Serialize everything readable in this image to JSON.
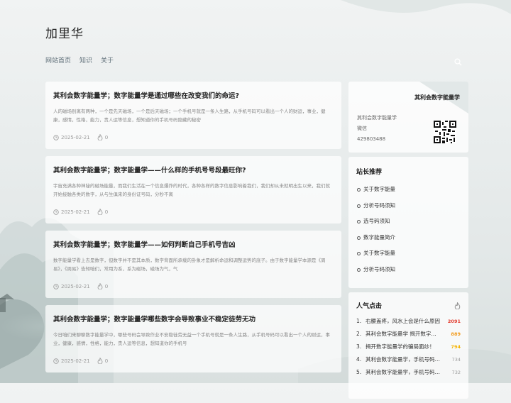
{
  "site": {
    "title": "加里华"
  },
  "nav": [
    {
      "label": "网站首页"
    },
    {
      "label": "知识"
    },
    {
      "label": "关于"
    }
  ],
  "posts": [
    {
      "title": "其利会数字能量学；数字能量学是通过哪些在改变我们的命运?",
      "excerpt": "人的磁场别离有两种，一个是先天磁场，一个是后天磁场；一个手机号就是一条人生路，从手机号码可以看出一个人的财运，事业，健康，感情，性格，能力，贵人运等信息，想知道你的手机号码隐藏的秘密",
      "date": "2025-02-21",
      "likes": "0"
    },
    {
      "title": "其利会数字能量学；数字能量学——什么样的手机号号段最旺你?",
      "excerpt": "宇宙充满各种神秘的磁场能量，而我们生活在一个信息爆炸的时代，各种各样的数字信息影响着我们，我们却从未就明出生以来，我们就开始接触各类的数字，从与生俱来的身份证号码，分秒不离",
      "date": "2025-02-21",
      "likes": "0"
    },
    {
      "title": "其利会数字能量学；数字能量学——如何判断自己手机号吉凶",
      "excerpt": "数字能量学看上去是数字，但数字并不是其本质，数字背面所承载的卦象才是解析命运和调整运势的底子。由于数字能量学本源是《周易》，《周易》告知咱们，常用为系，系为磁场，磁场为气，气",
      "date": "2025-02-21",
      "likes": "0"
    },
    {
      "title": "其利会数字能量学；数字能量学哪些数字会导致事业不稳定徒劳无功",
      "excerpt": "今日咱们来聊聊数字能量学中，哪些号码会导致作业不安稳徒劳无益一个手机号就是一条人生路，从手机号码可以看出一个人的财运，事业，健康，感情，性格，能力，贵人运等信息，想知道你的手机号",
      "date": "2025-02-21",
      "likes": "0"
    }
  ],
  "profile": {
    "title": "其利会数字能量学",
    "line1": "其利会数字能量学",
    "line2": "微信",
    "line3": "429803488"
  },
  "recommend": {
    "heading": "站长推荐",
    "items": [
      "关于数字能量",
      "分析号码须知",
      "选号码须知",
      "数字能量简介",
      "关于数字能量",
      "分析号码须知"
    ]
  },
  "hot": {
    "heading": "人气点击",
    "items": [
      {
        "n": "1.",
        "title": "右腰盖疼，风水上会是什么原因",
        "count": "2091"
      },
      {
        "n": "2.",
        "title": "其利会数字能量学 揭开数字能量学的面纱",
        "count": "889"
      },
      {
        "n": "3.",
        "title": "揭开数字能量学的骗局面纱！",
        "count": "794"
      },
      {
        "n": "4.",
        "title": "其利会数字能量学，手机号码吉凶",
        "count": "734"
      },
      {
        "n": "5.",
        "title": "其利会数字能量学，手机号码分析",
        "count": "732"
      }
    ]
  },
  "colors": {
    "hot1": "#e23b2e",
    "hot2": "#f29c1f",
    "hot3": "#f5b400",
    "hotRest": "#999999"
  }
}
